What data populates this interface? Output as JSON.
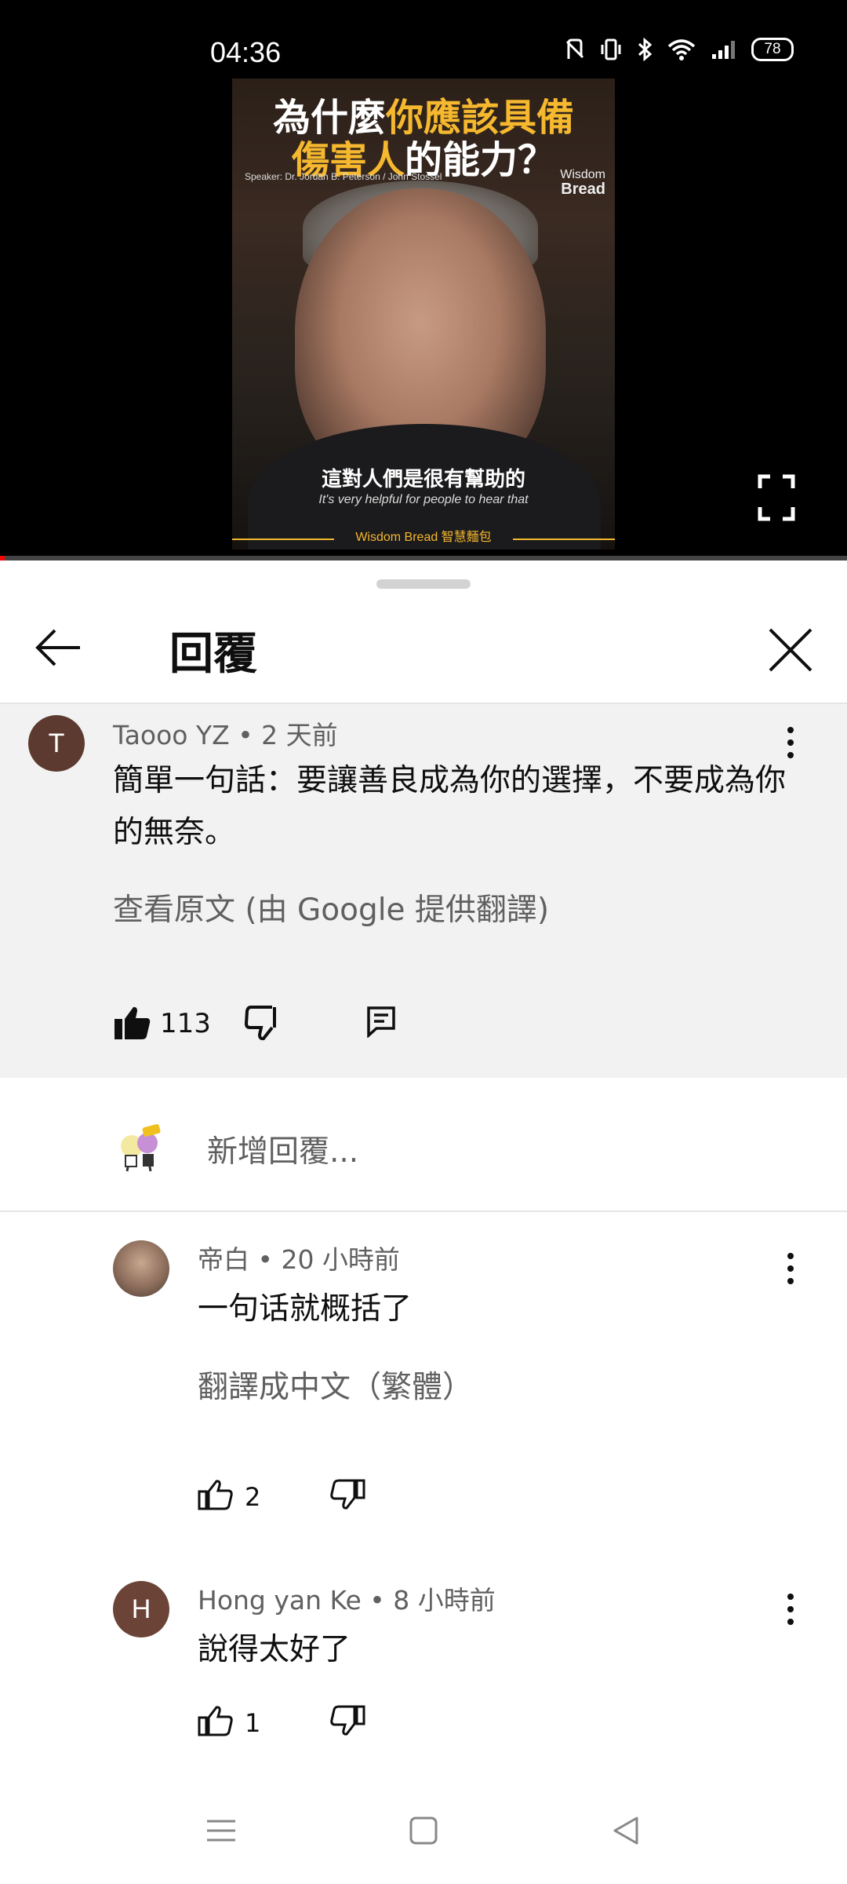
{
  "status_bar": {
    "time": "04:36",
    "battery": "78"
  },
  "video": {
    "title_line1_a": "為什麼",
    "title_line1_b": "你應該具備",
    "title_line2_a": "傷害人",
    "title_line2_b": "的能力？",
    "speaker": "Speaker: Dr. Jordan B. Peterson / John Stossel",
    "brand_top": "Wisdom",
    "brand_bottom": "Bread",
    "subtitle_zh": "這對人們是很有幫助的",
    "subtitle_en": "It's very helpful for people to hear that",
    "footer": "Wisdom Bread 智慧麵包",
    "progress": 0.005
  },
  "sheet": {
    "title": "回覆"
  },
  "parent_comment": {
    "avatar_letter": "T",
    "meta": "Taooo YZ • 2 天前",
    "text": "簡單一句話：要讓善良成為你的選擇，不要成為你的無奈。",
    "translate_link": "查看原文 (由 Google 提供翻譯)",
    "likes": "113"
  },
  "add_reply": {
    "placeholder": "新增回覆..."
  },
  "replies": [
    {
      "meta": "帝白 • 20 小時前",
      "text": "一句话就概括了",
      "translate_link": "翻譯成中文（繁體）",
      "likes": "2"
    },
    {
      "avatar_letter": "H",
      "meta": "Hong yan Ke • 8 小時前",
      "text": "說得太好了",
      "likes": "1"
    }
  ],
  "colors": {
    "accent": "#f5b82e",
    "progress": "#ff0000",
    "secondary_text": "#606060",
    "highlight_bg": "#f2f2f2"
  }
}
